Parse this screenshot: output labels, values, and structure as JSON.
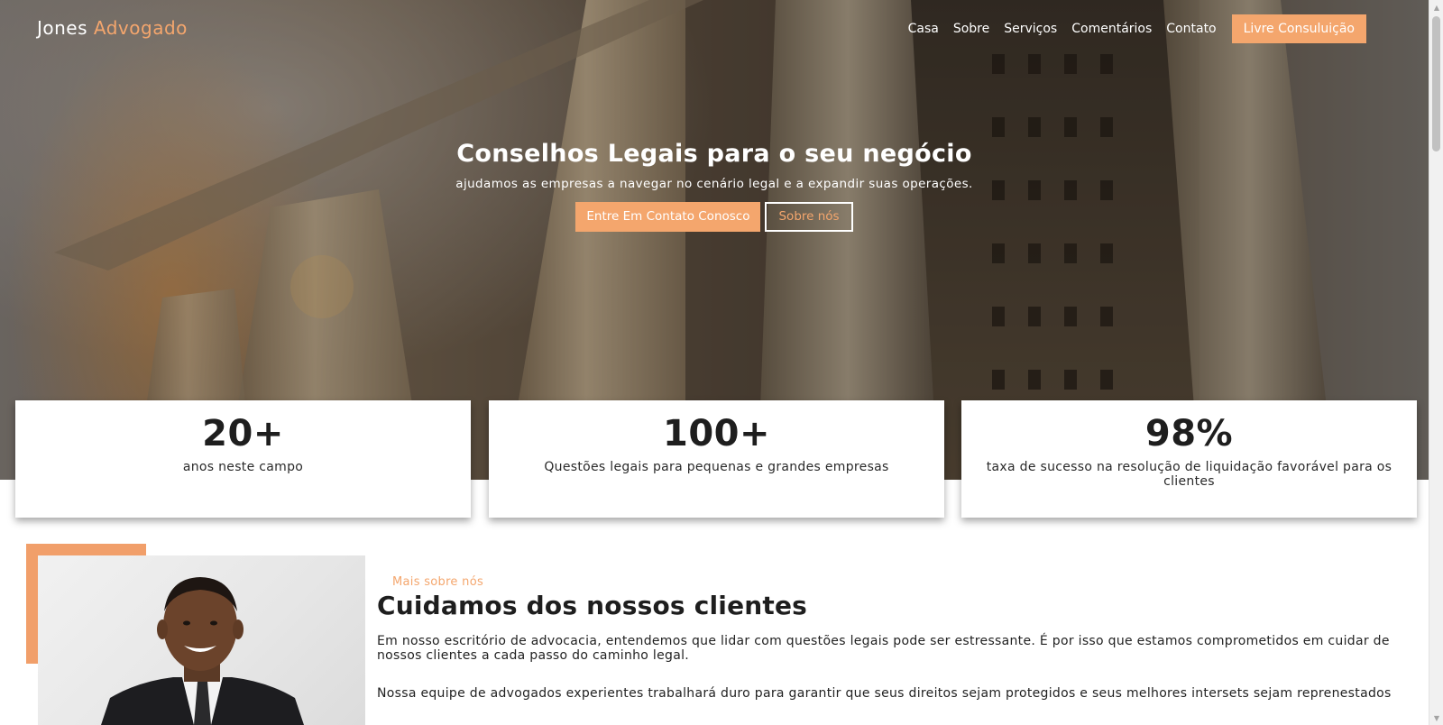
{
  "brand": {
    "name_part1": "Jones",
    "name_part2": "Advogado"
  },
  "nav": {
    "links": [
      "Casa",
      "Sobre",
      "Serviços",
      "Comentários",
      "Contato"
    ],
    "cta": "Livre Consuluição"
  },
  "hero": {
    "title": "Conselhos Legais para o seu negócio",
    "subtitle": "ajudamos as empresas a navegar no cenário legal e a expandir suas operações.",
    "primary_button": "Entre Em Contato Conosco",
    "secondary_button": "Sobre nós"
  },
  "stats": [
    {
      "value": "20+",
      "label": "anos neste campo"
    },
    {
      "value": "100+",
      "label": "Questões legais para pequenas e grandes empresas"
    },
    {
      "value": "98%",
      "label": "taxa de sucesso na resolução de liquidação favorável para os clientes"
    }
  ],
  "about": {
    "eyebrow": "Mais sobre nós",
    "title": "Cuidamos dos nossos clientes",
    "paragraphs": [
      "Em nosso escritório de advocacia, entendemos que lidar com questões legais pode ser estressante. É por isso que estamos comprometidos em cuidar de nossos clientes a cada passo do caminho legal.",
      "Nossa equipe de advogados experientes trabalhará duro para garantir que seus direitos sejam protegidos e seus melhores intersets sejam reprenestados"
    ]
  },
  "colors": {
    "accent": "#f4a66d",
    "accent_block": "#f19f6a",
    "text": "#1e1e1e"
  },
  "icons": {
    "scroll_up": "triangle-up-icon",
    "scroll_down": "triangle-down-icon"
  }
}
